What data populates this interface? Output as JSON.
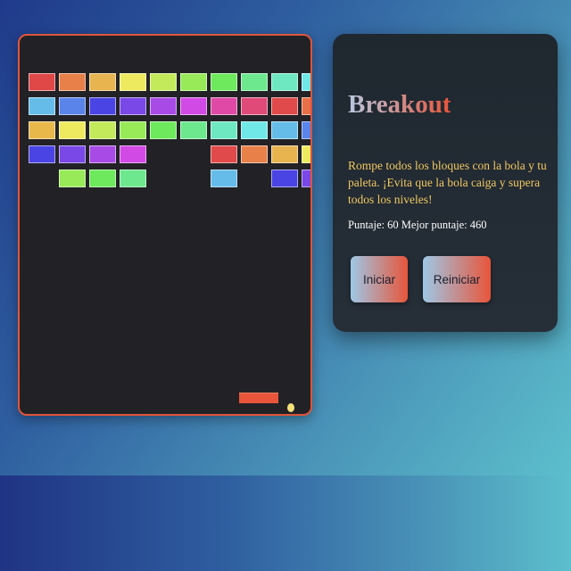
{
  "game": {
    "title": "Breakout",
    "description": "Rompe todos los bloques con la bola y tu paleta. ¡Evita que la bola caiga y supera todos los niveles!",
    "score_text": "Puntaje: 60 Mejor puntaje: 460",
    "score": 60,
    "best_score": 460,
    "buttons": {
      "start_label": "Iniciar",
      "reset_label": "Reiniciar"
    }
  },
  "colors": {
    "board_border": "#e0553a",
    "paddle": "#e8553a",
    "ball": "#f4e27a",
    "description_text": "#f0c860"
  },
  "bricks": [
    {
      "row": 0,
      "col": 0,
      "color": "#e04848"
    },
    {
      "row": 0,
      "col": 1,
      "color": "#e8804a"
    },
    {
      "row": 0,
      "col": 2,
      "color": "#e8b450"
    },
    {
      "row": 0,
      "col": 3,
      "color": "#eeea60"
    },
    {
      "row": 0,
      "col": 4,
      "color": "#c2ea5a"
    },
    {
      "row": 0,
      "col": 5,
      "color": "#98ea58"
    },
    {
      "row": 0,
      "col": 6,
      "color": "#6ee85c"
    },
    {
      "row": 0,
      "col": 7,
      "color": "#6ee88e"
    },
    {
      "row": 0,
      "col": 8,
      "color": "#6ee8c0"
    },
    {
      "row": 0,
      "col": 9,
      "color": "#70e8e8"
    },
    {
      "row": 1,
      "col": 0,
      "color": "#66bce8"
    },
    {
      "row": 1,
      "col": 1,
      "color": "#5a84ea"
    },
    {
      "row": 1,
      "col": 2,
      "color": "#4a44e4"
    },
    {
      "row": 1,
      "col": 3,
      "color": "#7a48e6"
    },
    {
      "row": 1,
      "col": 4,
      "color": "#a84ae6"
    },
    {
      "row": 1,
      "col": 5,
      "color": "#d24ae6"
    },
    {
      "row": 1,
      "col": 6,
      "color": "#e04aa6"
    },
    {
      "row": 1,
      "col": 7,
      "color": "#e04a78"
    },
    {
      "row": 1,
      "col": 8,
      "color": "#e04a4a"
    },
    {
      "row": 1,
      "col": 9,
      "color": "#e87048"
    },
    {
      "row": 2,
      "col": 0,
      "color": "#e8b84a"
    },
    {
      "row": 2,
      "col": 1,
      "color": "#eeea60"
    },
    {
      "row": 2,
      "col": 2,
      "color": "#c2ea5a"
    },
    {
      "row": 2,
      "col": 3,
      "color": "#98ea58"
    },
    {
      "row": 2,
      "col": 4,
      "color": "#6ee85c"
    },
    {
      "row": 2,
      "col": 5,
      "color": "#6ee88e"
    },
    {
      "row": 2,
      "col": 6,
      "color": "#6ee8c0"
    },
    {
      "row": 2,
      "col": 7,
      "color": "#70e8e8"
    },
    {
      "row": 2,
      "col": 8,
      "color": "#66bce8"
    },
    {
      "row": 2,
      "col": 9,
      "color": "#5a84ea"
    },
    {
      "row": 3,
      "col": 0,
      "color": "#4a44e4"
    },
    {
      "row": 3,
      "col": 1,
      "color": "#7a48e6"
    },
    {
      "row": 3,
      "col": 2,
      "color": "#a84ae6"
    },
    {
      "row": 3,
      "col": 3,
      "color": "#d24ae6"
    },
    {
      "row": 3,
      "col": 6,
      "color": "#e04a4a"
    },
    {
      "row": 3,
      "col": 7,
      "color": "#e8804a"
    },
    {
      "row": 3,
      "col": 8,
      "color": "#e8b450"
    },
    {
      "row": 3,
      "col": 9,
      "color": "#eeea60"
    },
    {
      "row": 4,
      "col": 1,
      "color": "#98ea58"
    },
    {
      "row": 4,
      "col": 2,
      "color": "#6ee85c"
    },
    {
      "row": 4,
      "col": 3,
      "color": "#6ee88e"
    },
    {
      "row": 4,
      "col": 6,
      "color": "#66bce8"
    },
    {
      "row": 4,
      "col": 8,
      "color": "#4a44e4"
    },
    {
      "row": 4,
      "col": 9,
      "color": "#7a48e6"
    }
  ]
}
